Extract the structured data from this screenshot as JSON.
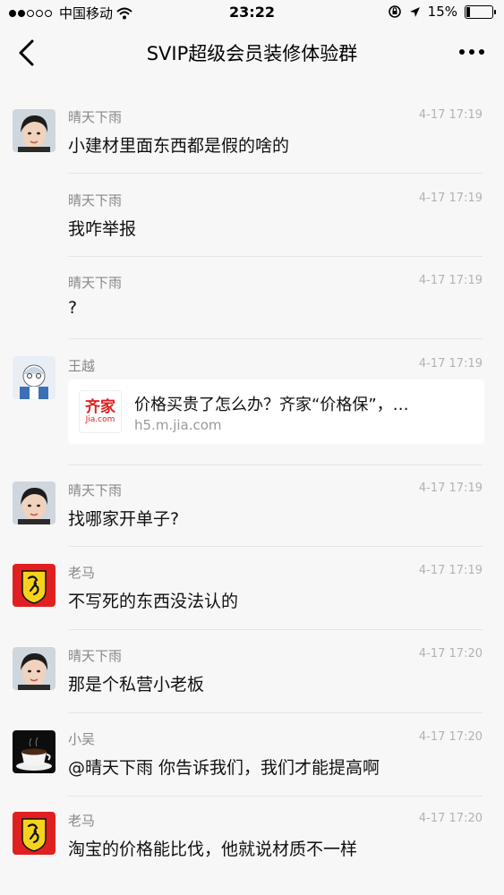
{
  "status": {
    "carrier": "中国移动",
    "time": "23:22",
    "battery": "15%",
    "battery_level": 0.15
  },
  "nav": {
    "title": "SVIP超级会员装修体验群"
  },
  "colors": {
    "background": "#f7f7f7",
    "sender": "#888888",
    "time": "#b2b2b2",
    "logo_red": "#e02020"
  },
  "messages": [
    {
      "sender": "晴天下雨",
      "time": "4-17 17:19",
      "text": "小建材里面东西都是假的啥的",
      "avatar": "sunny-avatar"
    },
    {
      "sender": "晴天下雨",
      "time": "4-17 17:19",
      "text": "我咋举报"
    },
    {
      "sender": "晴天下雨",
      "time": "4-17 17:19",
      "text": "?"
    },
    {
      "sender": "王越",
      "time": "4-17 17:19",
      "avatar": "wangyue-avatar",
      "card": {
        "title": "价格买贵了怎么办？齐家“价格保”，…",
        "url": "h5.m.jia.com",
        "logo_line1": "齐家",
        "logo_line2": "Jia.com"
      }
    },
    {
      "sender": "晴天下雨",
      "time": "4-17 17:19",
      "text": "找哪家开单子?",
      "avatar": "sunny-avatar"
    },
    {
      "sender": "老马",
      "time": "4-17 17:19",
      "text": "不写死的东西没法认的",
      "avatar": "laoma-avatar"
    },
    {
      "sender": "晴天下雨",
      "time": "4-17 17:20",
      "text": "那是个私营小老板",
      "avatar": "sunny-avatar"
    },
    {
      "sender": "小吴",
      "time": "4-17 17:20",
      "text": "@晴天下雨 你告诉我们，我们才能提高啊",
      "avatar": "coffee-avatar"
    },
    {
      "sender": "老马",
      "time": "4-17 17:20",
      "text": "淘宝的价格能比伐，他就说材质不一样",
      "avatar": "laoma-avatar"
    }
  ]
}
